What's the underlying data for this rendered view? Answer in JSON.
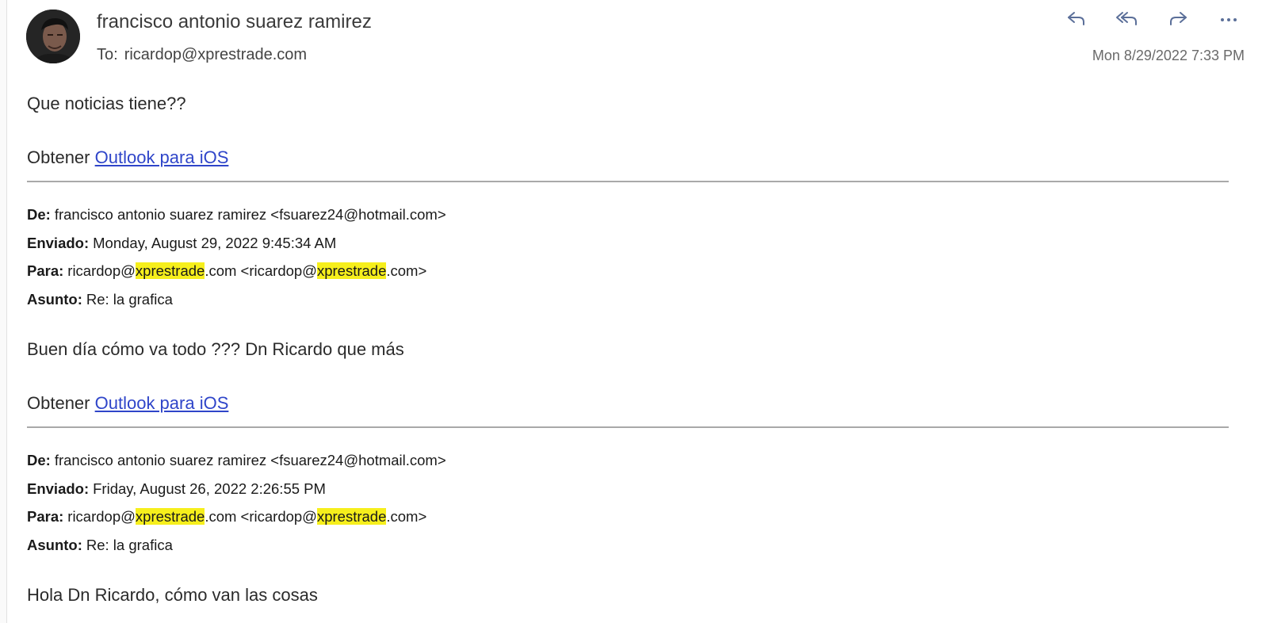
{
  "header": {
    "sender_name": "francisco antonio suarez ramirez",
    "to_label": "To:",
    "to_address": "ricardop@xprestrade.com",
    "timestamp": "Mon 8/29/2022 7:33 PM",
    "actions": [
      {
        "name": "reply-icon",
        "icon": "reply"
      },
      {
        "name": "reply-all-icon",
        "icon": "reply-all"
      },
      {
        "name": "forward-icon",
        "icon": "forward"
      },
      {
        "name": "more-icon",
        "icon": "more"
      }
    ]
  },
  "message": {
    "body": "Que noticias tiene??",
    "signature_prefix": "Obtener",
    "signature_link": "Outlook para iOS"
  },
  "quoted": [
    {
      "de_label": "De:",
      "de_value": "francisco antonio suarez ramirez <fsuarez24@hotmail.com>",
      "enviado_label": "Enviado:",
      "enviado_value": "Monday, August 29, 2022 9:45:34 AM",
      "para_label": "Para:",
      "para_user": "ricardop@",
      "para_domain": "xprestrade",
      "para_tld": ".com",
      "para_mid": " <ricardop@",
      "para_end": ".com>",
      "asunto_label": "Asunto:",
      "asunto_value": "Re: la grafica",
      "body": "Buen día cómo va todo ??? Dn Ricardo que más",
      "signature_prefix": "Obtener",
      "signature_link": "Outlook para iOS"
    },
    {
      "de_label": "De:",
      "de_value": "francisco antonio suarez ramirez <fsuarez24@hotmail.com>",
      "enviado_label": "Enviado:",
      "enviado_value": "Friday, August 26, 2022 2:26:55 PM",
      "para_label": "Para:",
      "para_user": "ricardop@",
      "para_domain": "xprestrade",
      "para_tld": ".com",
      "para_mid": " <ricardop@",
      "para_end": ".com>",
      "asunto_label": "Asunto:",
      "asunto_value": "Re: la grafica",
      "body": "Hola Dn Ricardo, cómo van las cosas"
    }
  ],
  "colors": {
    "link": "#2f45c9",
    "highlight": "#f6ef1c",
    "action_icon": "#5b6f99"
  }
}
